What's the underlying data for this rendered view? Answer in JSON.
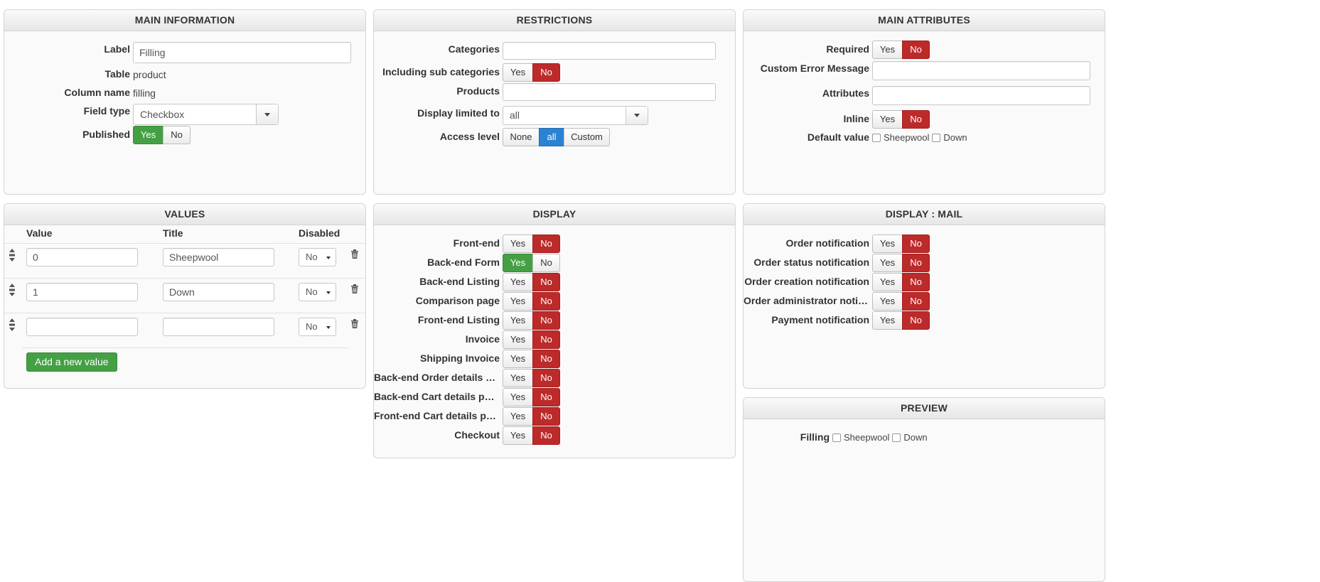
{
  "main_info": {
    "title": "MAIN INFORMATION",
    "label_label": "Label",
    "label_value": "Filling",
    "table_label": "Table",
    "table_value": "product",
    "column_label": "Column name",
    "column_value": "filling",
    "fieldtype_label": "Field type",
    "fieldtype_value": "Checkbox",
    "published_label": "Published",
    "yes": "Yes",
    "no": "No",
    "published": "Yes"
  },
  "restrictions": {
    "title": "RESTRICTIONS",
    "categories_label": "Categories",
    "categories_value": "",
    "subcat_label": "Including sub categories",
    "subcat": "No",
    "products_label": "Products",
    "products_value": "",
    "display_limited_label": "Display limited to",
    "display_limited_value": "all",
    "access_label": "Access level",
    "access_options": [
      "None",
      "all",
      "Custom"
    ],
    "access_selected": "all",
    "yes": "Yes",
    "no": "No"
  },
  "main_attributes": {
    "title": "MAIN ATTRIBUTES",
    "required_label": "Required",
    "required": "No",
    "error_label": "Custom Error Message",
    "error_value": "",
    "attributes_label": "Attributes",
    "attributes_value": "",
    "inline_label": "Inline",
    "inline": "No",
    "default_label": "Default value",
    "default_options": [
      "Sheepwool",
      "Down"
    ],
    "yes": "Yes",
    "no": "No"
  },
  "values": {
    "title": "VALUES",
    "col_value": "Value",
    "col_title": "Title",
    "col_disabled": "Disabled",
    "rows": [
      {
        "value": "0",
        "title": "Sheepwool",
        "disabled": "No"
      },
      {
        "value": "1",
        "title": "Down",
        "disabled": "No"
      },
      {
        "value": "",
        "title": "",
        "disabled": "No"
      }
    ],
    "add_label": "Add a new value"
  },
  "display": {
    "title": "DISPLAY",
    "yes": "Yes",
    "no": "No",
    "rows": [
      {
        "label": "Front-end",
        "state": "No"
      },
      {
        "label": "Back-end Form",
        "state": "Yes"
      },
      {
        "label": "Back-end Listing",
        "state": "No"
      },
      {
        "label": "Comparison page",
        "state": "No"
      },
      {
        "label": "Front-end Listing",
        "state": "No"
      },
      {
        "label": "Invoice",
        "state": "No"
      },
      {
        "label": "Shipping Invoice",
        "state": "No"
      },
      {
        "label": "Back-end Order details page",
        "state": "No"
      },
      {
        "label": "Back-end Cart details page",
        "state": "No"
      },
      {
        "label": "Front-end Cart details page",
        "state": "No"
      },
      {
        "label": "Checkout",
        "state": "No"
      }
    ]
  },
  "display_mail": {
    "title": "DISPLAY : MAIL",
    "yes": "Yes",
    "no": "No",
    "rows": [
      {
        "label": "Order notification",
        "state": "No"
      },
      {
        "label": "Order status notification",
        "state": "No"
      },
      {
        "label": "Order creation notification",
        "state": "No"
      },
      {
        "label": "Order administrator notific…",
        "state": "No"
      },
      {
        "label": "Payment notification",
        "state": "No"
      }
    ]
  },
  "preview": {
    "title": "PREVIEW",
    "field_label": "Filling",
    "options": [
      "Sheepwool",
      "Down"
    ]
  },
  "colors": {
    "no_active": "#bd2a2a",
    "yes_active": "#45a045",
    "selected_blue": "#2a82d0"
  }
}
